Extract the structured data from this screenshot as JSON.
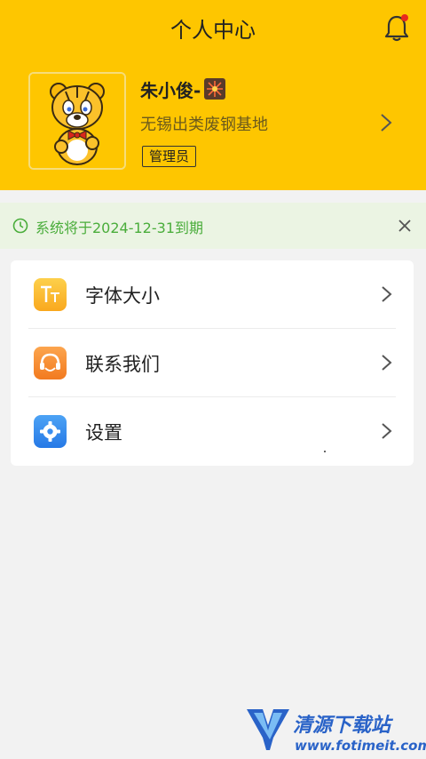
{
  "header": {
    "title": "个人中心",
    "bell_icon": "bell-icon",
    "background": "#fec600"
  },
  "profile": {
    "name": "朱小俊-",
    "emoji_icon": "firework-icon",
    "company": "无锡出类废钢基地",
    "role": "管理员"
  },
  "notice": {
    "text": "系统将于2024-12-31到期",
    "color": "#4aad3b"
  },
  "menu": [
    {
      "label": "字体大小",
      "icon": "font-size-icon"
    },
    {
      "label": "联系我们",
      "icon": "contact-support-icon"
    },
    {
      "label": "设置",
      "icon": "settings-gear-icon"
    }
  ],
  "watermark": {
    "title": "清源下载站",
    "url": "www.fotimeit.com"
  }
}
